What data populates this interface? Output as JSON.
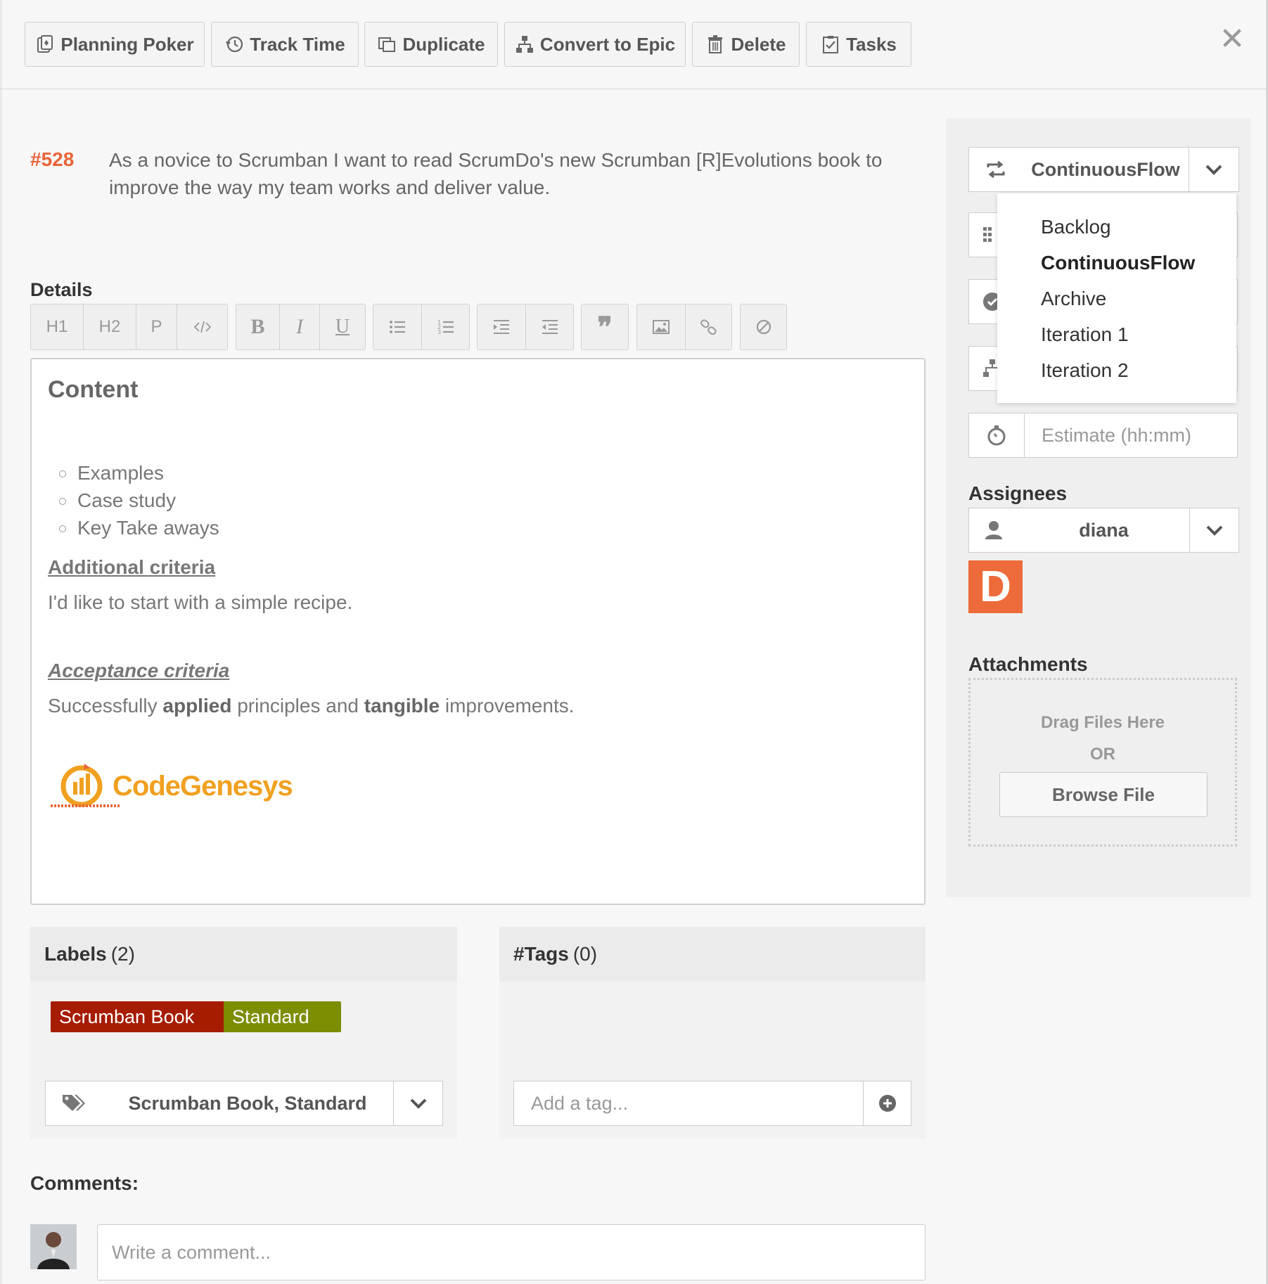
{
  "toolbar": {
    "buttons": [
      {
        "label": "Planning Poker",
        "icon": "cards-icon"
      },
      {
        "label": "Track Time",
        "icon": "history-clock-icon"
      },
      {
        "label": "Duplicate",
        "icon": "duplicate-icon"
      },
      {
        "label": "Convert to Epic",
        "icon": "hierarchy-icon"
      },
      {
        "label": "Delete",
        "icon": "trash-icon"
      },
      {
        "label": "Tasks",
        "icon": "checklist-icon"
      }
    ],
    "close_icon": "close-icon"
  },
  "story": {
    "id": "#528",
    "title": "As a novice to Scrumban I want to read ScrumDo's new Scrumban [R]Evolutions book to improve the way my team works and deliver value."
  },
  "details": {
    "label": "Details",
    "format_buttons": [
      "H1",
      "H2",
      "P"
    ],
    "content": {
      "heading": "Content",
      "list": [
        "Examples",
        "Case study",
        "Key Take aways"
      ],
      "sub1": "Additional criteria",
      "p1": "I'd like to start with a simple recipe.",
      "sub2": "Acceptance criteria",
      "p2_parts": [
        "Successfully ",
        "applied",
        " principles and ",
        "tangible",
        " improvements."
      ],
      "logo_text": "CodeGenesys"
    }
  },
  "labels": {
    "title": "Labels",
    "count": "(2)",
    "chips": [
      {
        "text": "Scrumban Book",
        "color": "#a61c00"
      },
      {
        "text": "Standard",
        "color": "#7d8d00"
      }
    ],
    "selected": "Scrumban Book, Standard"
  },
  "tags": {
    "title": "#Tags",
    "count": "(0)",
    "placeholder": "Add a tag..."
  },
  "sidebar": {
    "workflow": "ContinuousFlow",
    "menu": [
      "Backlog",
      "ContinuousFlow",
      "Archive",
      "Iteration 1",
      "Iteration 2"
    ],
    "menu_active": "ContinuousFlow",
    "estimate_placeholder": "Estimate (hh:mm)",
    "assignees_label": "Assignees",
    "assignee": "diana",
    "assignee_initial": "D",
    "assignee_color": "#ed6a3b",
    "attachments_label": "Attachments",
    "drag_text": "Drag Files Here",
    "or_text": "OR",
    "browse_label": "Browse File"
  },
  "comments": {
    "label": "Comments:",
    "placeholder": "Write a comment..."
  },
  "colors": {
    "accent": "#e8643a"
  }
}
